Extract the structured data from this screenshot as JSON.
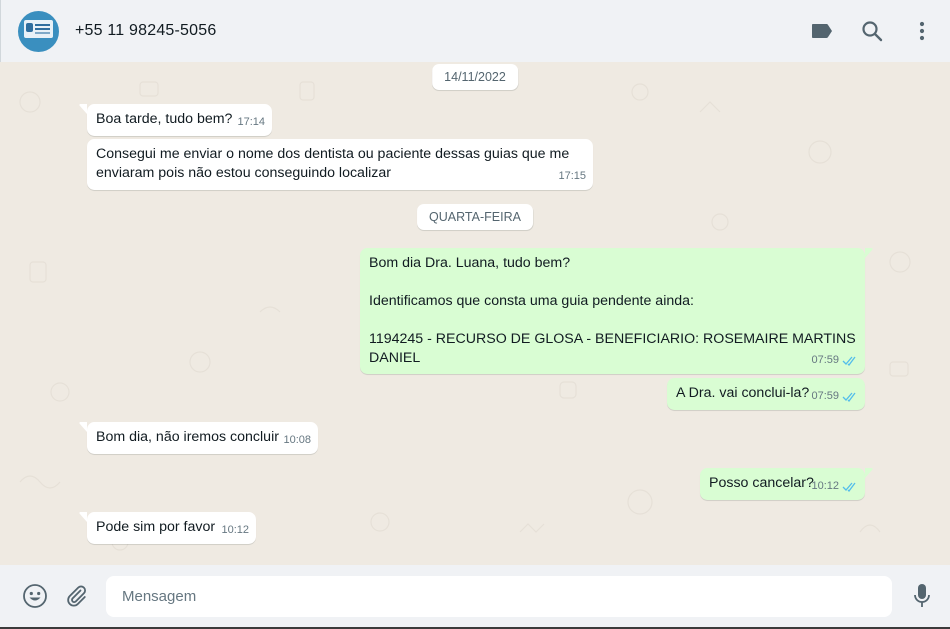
{
  "header": {
    "contact_name": "+55 11 98245-5056",
    "icons": [
      "label-icon",
      "search-icon",
      "more-vert-icon"
    ]
  },
  "chat": {
    "dates": [
      "14/11/2022",
      "QUARTA-FEIRA"
    ],
    "messages": [
      {
        "direction": "in",
        "text": "Boa tarde, tudo bem?",
        "time": "17:14"
      },
      {
        "direction": "in",
        "text": "Consegui me enviar o nome dos dentista ou paciente dessas guias que me\nenviaram pois não estou conseguindo localizar",
        "time": "17:15"
      },
      {
        "direction": "out",
        "text": "Bom dia Dra. Luana, tudo bem?\n\nIdentificamos que consta uma guia pendente ainda:\n\n1194245 - RECURSO DE GLOSA - BENEFICIARIO: ROSEMAIRE MARTINS\nDANIEL",
        "time": "07:59",
        "status": "read"
      },
      {
        "direction": "out",
        "text": "A Dra. vai conclui-la?",
        "time": "07:59",
        "status": "read"
      },
      {
        "direction": "in",
        "text": "Bom dia, não iremos concluir",
        "time": "10:08"
      },
      {
        "direction": "out",
        "text": "Posso cancelar?",
        "time": "10:12",
        "status": "read"
      },
      {
        "direction": "in",
        "text": "Pode sim por favor",
        "time": "10:12"
      }
    ]
  },
  "footer": {
    "input_placeholder": "Mensagem",
    "icons": [
      "emoji-icon",
      "attach-icon",
      "microphone-icon"
    ]
  },
  "colors": {
    "header_bg": "#f0f2f5",
    "chat_bg": "#efeae2",
    "incoming_bubble": "#ffffff",
    "outgoing_bubble": "#d9fdd3",
    "read_ticks": "#53bdeb",
    "icon_gray": "#54656f"
  }
}
